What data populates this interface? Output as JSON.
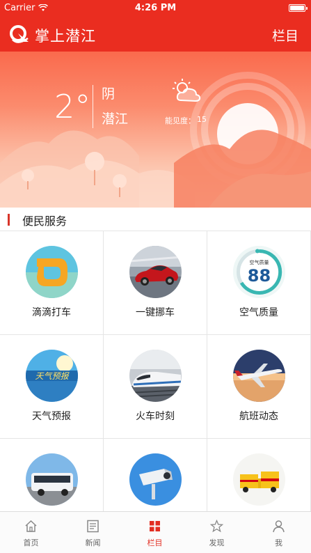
{
  "status_bar": {
    "carrier": "Carrier",
    "time": "4:26 PM"
  },
  "header": {
    "title": "掌上潜江",
    "menu_label": "栏目"
  },
  "weather": {
    "temperature": "2°",
    "condition": "阴",
    "city": "潜江",
    "visibility_label": "能见度：",
    "visibility_value": "15"
  },
  "section": {
    "title": "便民服务"
  },
  "services": [
    {
      "label": "滴滴打车",
      "icon": "didi-logo-icon"
    },
    {
      "label": "一键挪车",
      "icon": "red-sports-car-icon"
    },
    {
      "label": "空气质量",
      "icon": "air-quality-gauge-icon",
      "badge_label": "空气质量",
      "badge_value": "88"
    },
    {
      "label": "天气预报",
      "icon": "weather-forecast-icon",
      "badge_text": "天气预报"
    },
    {
      "label": "火车时刻",
      "icon": "high-speed-train-icon"
    },
    {
      "label": "航班动态",
      "icon": "airplane-icon"
    },
    {
      "label": "",
      "icon": "bus-icon"
    },
    {
      "label": "",
      "icon": "traffic-camera-icon"
    },
    {
      "label": "",
      "icon": "delivery-trucks-icon"
    }
  ],
  "tabs": [
    {
      "label": "首页",
      "icon": "home-icon"
    },
    {
      "label": "新闻",
      "icon": "news-icon"
    },
    {
      "label": "栏目",
      "icon": "grid-icon",
      "active": true
    },
    {
      "label": "发现",
      "icon": "discover-icon"
    },
    {
      "label": "我",
      "icon": "user-icon"
    }
  ],
  "colors": {
    "brand_red": "#ea2d20",
    "active_tab": "#e22d21",
    "section_bar": "#d8352a"
  }
}
